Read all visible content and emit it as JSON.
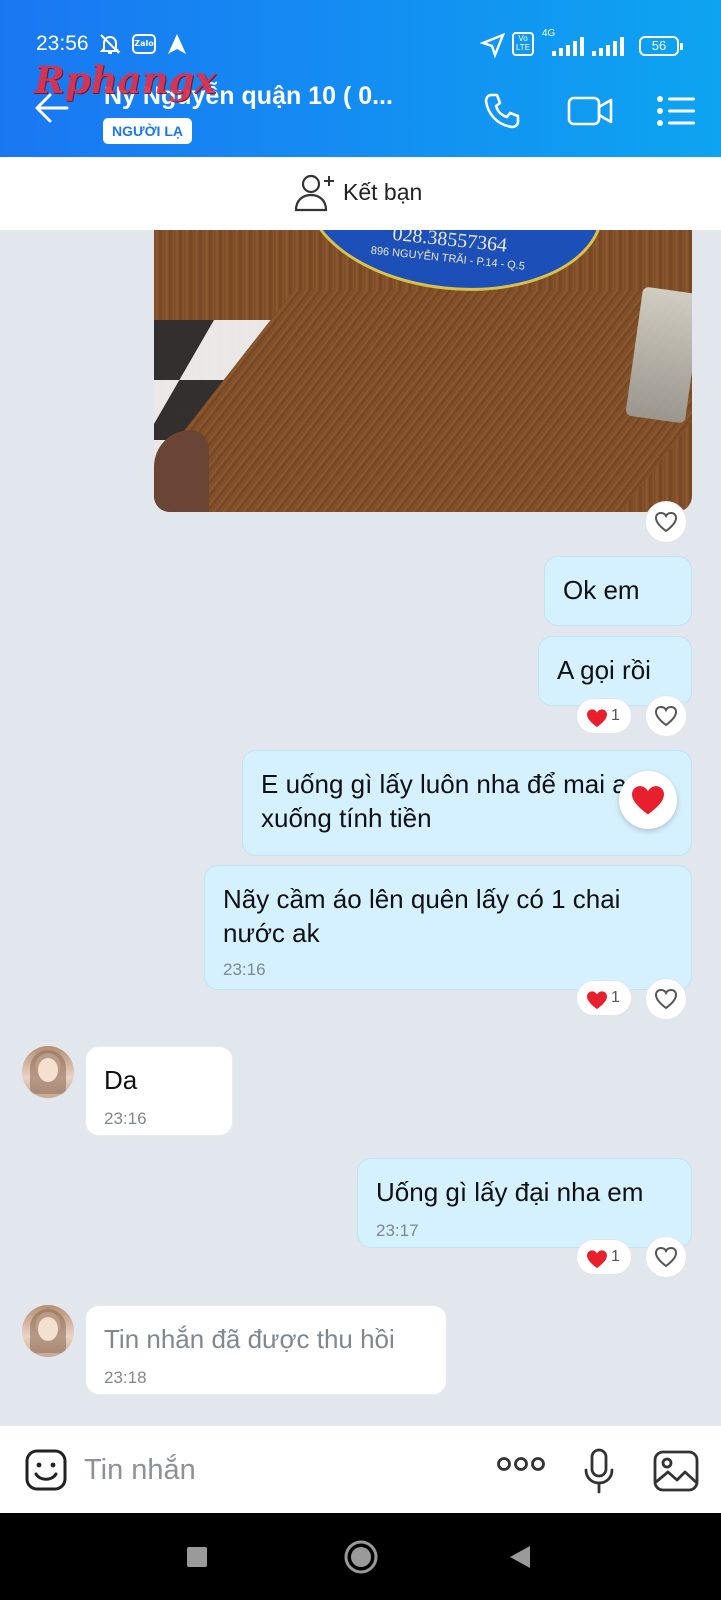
{
  "status_bar": {
    "time": "23:56",
    "zalo_badge": "Zalo",
    "network": "4G",
    "network_sub": "Vo LTE",
    "battery": "56",
    "icons": [
      "notifications-off-icon",
      "zalo-app-icon",
      "navigation-icon",
      "location-arrow-icon",
      "volte-icon",
      "signal-icon",
      "signal-icon",
      "battery-icon"
    ]
  },
  "header": {
    "title": "Ny Nguyễn quận 10 ( 0...",
    "badge": "NGƯỜI LẠ",
    "watermark": "Rphangx",
    "icons": [
      "back-arrow-icon",
      "phone-icon",
      "video-call-icon",
      "menu-list-icon"
    ]
  },
  "add_friend": {
    "label": "Kết bạn",
    "icon": "add-person-icon"
  },
  "photo_message": {
    "sticker_phone": "028.38557364",
    "sticker_address": "896 NGUYỄN TRÃI - P.14 - Q.5"
  },
  "messages": [
    {
      "side": "out",
      "text": "Ok em"
    },
    {
      "side": "out",
      "text": "A gọi rồi",
      "reaction_count": "1"
    },
    {
      "side": "out",
      "line1": "E uống gì lấy luôn nha để mai a",
      "line2": "xuống tính tiền"
    },
    {
      "side": "out",
      "line1": "Nãy cầm áo lên quên lấy có 1 chai",
      "line2": "nước ak",
      "time": "23:16",
      "reaction_count": "1"
    },
    {
      "side": "in",
      "text": "Da",
      "time": "23:16"
    },
    {
      "side": "out",
      "text": "Uống gì lấy đại nha em",
      "time": "23:17",
      "reaction_count": "1"
    },
    {
      "side": "in",
      "text": "Tin nhắn đã được thu hồi",
      "time": "23:18",
      "recalled": true
    }
  ],
  "composer": {
    "placeholder": "Tin nhắn",
    "icons": [
      "emoji-icon",
      "more-dots-icon",
      "microphone-icon",
      "image-icon"
    ]
  },
  "colors": {
    "header_start": "#1a77f2",
    "header_end": "#0da4f1",
    "outgoing_bubble": "#d5f1ff",
    "incoming_bubble": "#ffffff",
    "chat_background": "#e2e7ee",
    "heart": "#e8202e"
  }
}
